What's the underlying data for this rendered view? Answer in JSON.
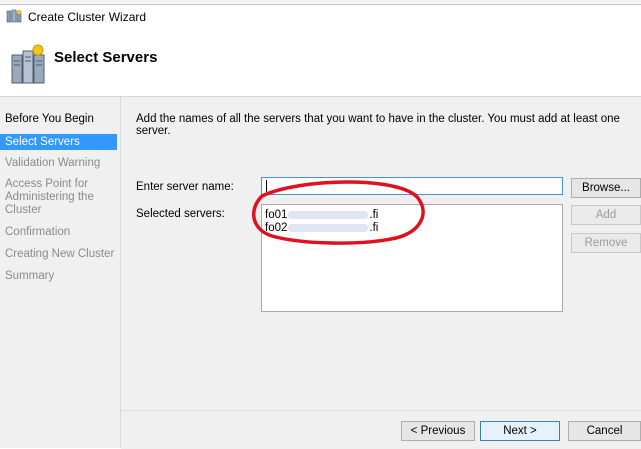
{
  "window": {
    "title": "Create Cluster Wizard"
  },
  "header": {
    "heading": "Select Servers",
    "icon": "cluster-servers-icon"
  },
  "nav": {
    "items": [
      {
        "label": "Before You Begin",
        "state": "done"
      },
      {
        "label": "Select Servers",
        "state": "active"
      },
      {
        "label": "Validation Warning",
        "state": "pending"
      },
      {
        "label": "Access Point for Administering the Cluster",
        "state": "pending"
      },
      {
        "label": "Confirmation",
        "state": "pending"
      },
      {
        "label": "Creating New Cluster",
        "state": "pending"
      },
      {
        "label": "Summary",
        "state": "pending"
      }
    ]
  },
  "main": {
    "instructions": "Add the names of all the servers that you want to have in the cluster. You must add at least one server.",
    "server_name_label": "Enter server name:",
    "server_name_value": "",
    "selected_label": "Selected servers:",
    "selected_servers": [
      {
        "prefix": "fo01",
        "suffix": ".fi"
      },
      {
        "prefix": "fo02",
        "suffix": ".fi"
      }
    ],
    "browse_label": "Browse...",
    "add_label": "Add",
    "remove_label": "Remove"
  },
  "footer": {
    "previous_label": "< Previous",
    "next_label": "Next >",
    "cancel_label": "Cancel"
  },
  "colors": {
    "selection": "#3399ff",
    "annotation": "#e0101e"
  }
}
